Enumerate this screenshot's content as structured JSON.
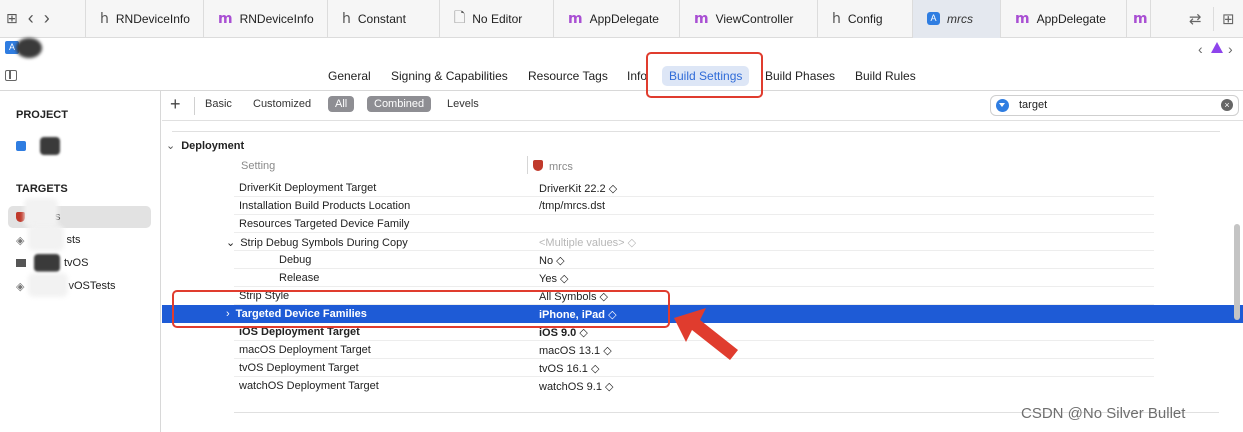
{
  "window_tabs": [
    {
      "icon": "h",
      "label": "RNDeviceInfo"
    },
    {
      "icon": "m",
      "label": "RNDeviceInfo"
    },
    {
      "icon": "h",
      "label": "Constant"
    },
    {
      "icon": "doc",
      "label": "No Editor"
    },
    {
      "icon": "m",
      "label": "AppDelegate"
    },
    {
      "icon": "m",
      "label": "ViewController"
    },
    {
      "icon": "h",
      "label": "Config"
    },
    {
      "icon": "xcode",
      "label": "mrcs",
      "active": true
    },
    {
      "icon": "m",
      "label": "AppDelegate"
    },
    {
      "icon": "m",
      "label": "m"
    }
  ],
  "icons": {
    "grid": "grid-icon",
    "back": "chevron-left-icon",
    "forward": "chevron-right-icon",
    "swap": "swap-arrows-icon",
    "add_editor": "split-editor-icon",
    "warning": "warning-triangle-icon"
  },
  "editor_tabs": {
    "general": "General",
    "signing": "Signing & Capabilities",
    "resource_tags": "Resource Tags",
    "info": "Info",
    "build_settings": "Build Settings",
    "build_phases": "Build Phases",
    "build_rules": "Build Rules"
  },
  "sidebar": {
    "project_title": "PROJECT",
    "targets_title": "TARGETS",
    "targets": [
      {
        "label": "s"
      },
      {
        "label": "sts"
      },
      {
        "label": "tvOS"
      },
      {
        "label": "vOSTests"
      }
    ]
  },
  "filter_bar": {
    "add": "+",
    "basic": "Basic",
    "customized": "Customized",
    "all": "All",
    "combined": "Combined",
    "levels": "Levels",
    "search_value": "target",
    "clear": "×"
  },
  "settings": {
    "group": "Deployment",
    "col_setting": "Setting",
    "col_target": "mrcs",
    "rows": [
      {
        "key": "DriverKit Deployment Target",
        "value": "DriverKit 22.2 ◇"
      },
      {
        "key": "Installation Build Products Location",
        "value": "/tmp/mrcs.dst"
      },
      {
        "key": "Resources Targeted Device Family",
        "value": ""
      },
      {
        "key": "Strip Debug Symbols During Copy",
        "value": "<Multiple values> ◇"
      },
      {
        "key": "Debug",
        "value": "No ◇"
      },
      {
        "key": "Release",
        "value": "Yes ◇"
      },
      {
        "key": "Strip Style",
        "value": "All Symbols ◇"
      },
      {
        "key": "Targeted Device Families",
        "value": "iPhone, iPad ◇"
      },
      {
        "key": "iOS Deployment Target",
        "value": "iOS 9.0 ◇"
      },
      {
        "key": "macOS Deployment Target",
        "value": "macOS 13.1 ◇"
      },
      {
        "key": "tvOS Deployment Target",
        "value": "tvOS 16.1 ◇"
      },
      {
        "key": "watchOS Deployment Target",
        "value": "watchOS 9.1 ◇"
      }
    ]
  },
  "colors": {
    "selection": "#1e5bd6",
    "annotation": "#e03c2e",
    "active_tab": "#2f6bd8"
  },
  "watermark": "CSDN @No Silver Bullet"
}
